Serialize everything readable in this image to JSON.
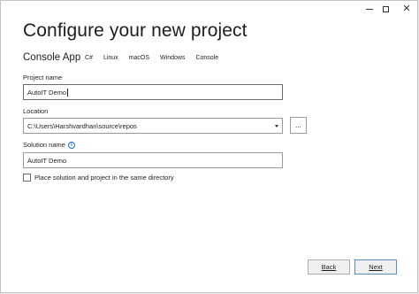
{
  "window": {
    "controls": {
      "minimize_icon": "minimize-icon",
      "maximize_icon": "maximize-icon",
      "close_glyph": "✕"
    }
  },
  "header": {
    "title": "Configure your new project",
    "template_name": "Console App",
    "tags": [
      "C#",
      "Linux",
      "macOS",
      "Windows",
      "Console"
    ]
  },
  "form": {
    "project_name": {
      "label": "Project name",
      "value": "AutoIT Demo"
    },
    "location": {
      "label": "Location",
      "value": "C:\\Users\\Harshvardhan\\source\\repos",
      "browse_label": "..."
    },
    "solution_name": {
      "label": "Solution name",
      "value": "AutoIT Demo",
      "info_glyph": "i"
    },
    "same_directory": {
      "label": "Place solution and project in the same directory",
      "checked": false
    }
  },
  "footer": {
    "back_label": "Back",
    "next_label": "Next"
  },
  "colors": {
    "accent": "#1f6ab8",
    "border": "#9a9aa0",
    "background": "#ffffff"
  }
}
